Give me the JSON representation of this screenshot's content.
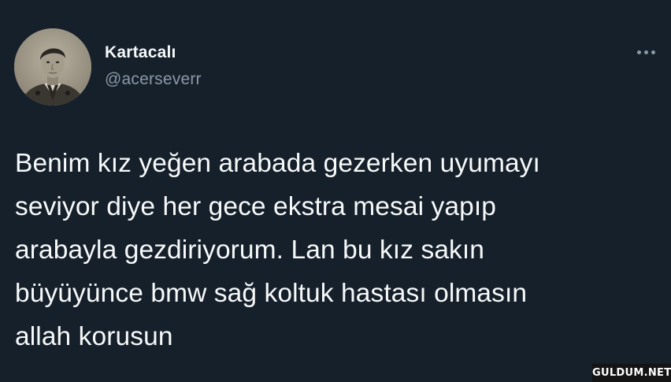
{
  "tweet": {
    "author": {
      "display_name": "Kartacalı",
      "handle": "@acerseverr",
      "avatar_icon": "profile-photo"
    },
    "more_icon": "more-horizontal-icon",
    "text": "Benim kız yeğen arabada gezerken uyumayı\nseviyor diye her gece ekstra mesai yapıp\narabayla gezdiriyorum. Lan bu kız sakın\nbüyüyünce bmw sağ koltuk hastası olmasın\nallah korusun"
  },
  "watermark": {
    "text": "GULDUM.NET"
  },
  "colors": {
    "background": "#15202b",
    "primary_text": "#f7f9f9",
    "secondary_text": "#8b98a5"
  }
}
